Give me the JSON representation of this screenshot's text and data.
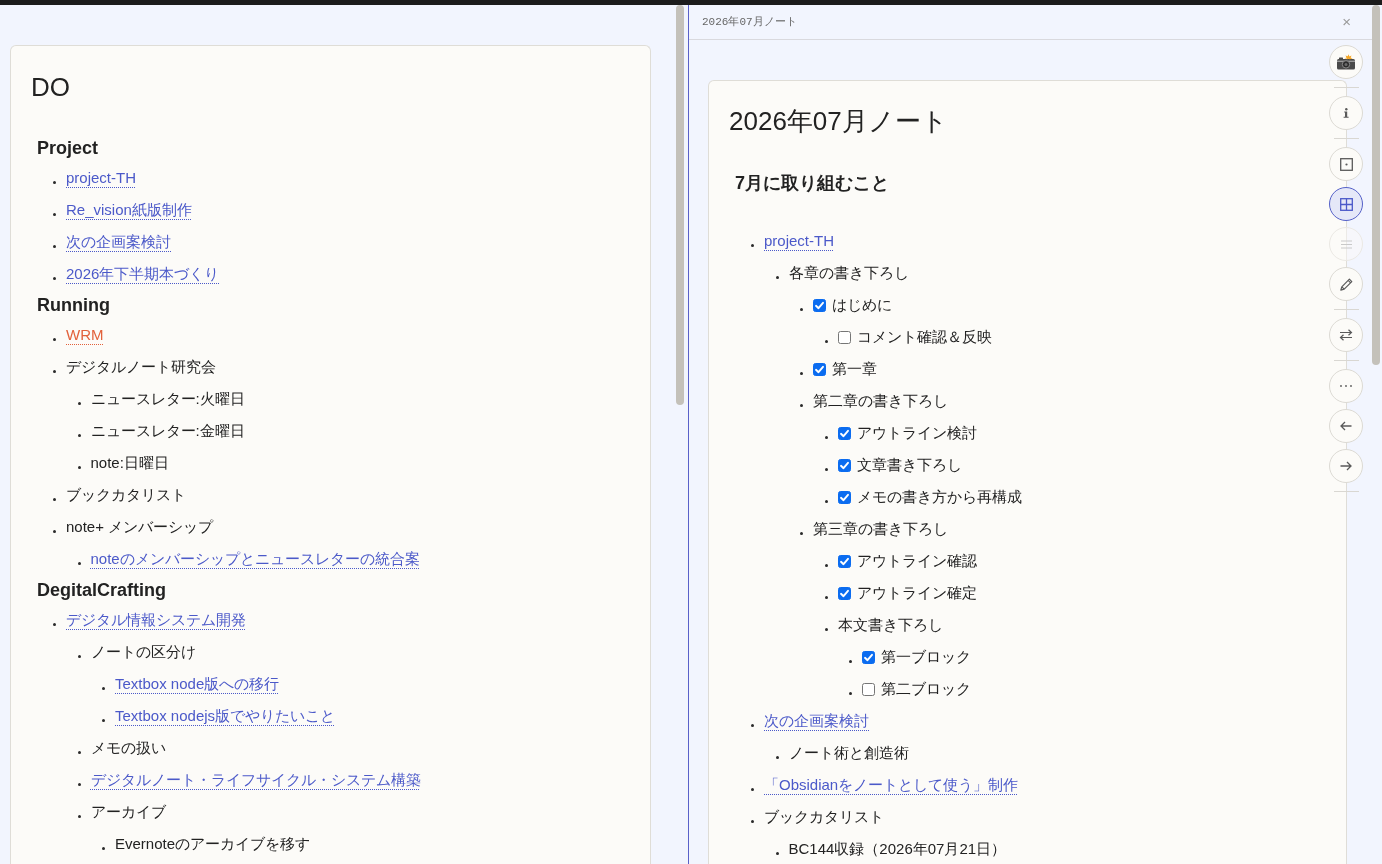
{
  "left_pane": {
    "title": "DO",
    "sections": [
      {
        "heading": "Project",
        "items": [
          {
            "kind": "link",
            "text": "project-TH"
          },
          {
            "kind": "link",
            "text": "Re_vision紙版制作"
          },
          {
            "kind": "link",
            "text": "次の企画案検討"
          },
          {
            "kind": "link",
            "text": "2026年下半期本づくり"
          }
        ]
      },
      {
        "heading": "Running",
        "items": [
          {
            "kind": "missing_link",
            "text": "WRM"
          },
          {
            "kind": "text",
            "text": "デジタルノート研究会",
            "children": [
              {
                "kind": "text",
                "text": "ニュースレター:火曜日"
              },
              {
                "kind": "text",
                "text": "ニュースレター:金曜日"
              },
              {
                "kind": "text",
                "text": "note:日曜日"
              }
            ]
          },
          {
            "kind": "text",
            "text": "ブックカタリスト"
          },
          {
            "kind": "text",
            "text": "note+ メンバーシップ",
            "children": [
              {
                "kind": "link",
                "text": "noteのメンバーシップとニュースレターの統合案"
              }
            ]
          }
        ]
      },
      {
        "heading": "DegitalCrafting",
        "items": [
          {
            "kind": "link",
            "text": "デジタル情報システム開発",
            "children": [
              {
                "kind": "text",
                "text": "ノートの区分け",
                "children": [
                  {
                    "kind": "link",
                    "text": "Textbox node版への移行"
                  },
                  {
                    "kind": "link",
                    "text": "Textbox nodejs版でやりたいこと"
                  }
                ]
              },
              {
                "kind": "text",
                "text": "メモの扱い"
              },
              {
                "kind": "link",
                "text": "デジタルノート・ライフサイクル・システム構築"
              },
              {
                "kind": "text",
                "text": "アーカイブ",
                "children": [
                  {
                    "kind": "text",
                    "text": "Evernoteのアーカイブを移す"
                  }
                ]
              }
            ]
          }
        ]
      }
    ]
  },
  "right_pane": {
    "tab_title": "2026年07月ノート",
    "close_label": "×",
    "title": "2026年07月ノート",
    "heading": "7月に取り組むこと",
    "items": [
      {
        "kind": "link",
        "text": "project-TH",
        "children": [
          {
            "kind": "text",
            "text": "各章の書き下ろし",
            "children": [
              {
                "kind": "task",
                "text": "はじめに",
                "checked": true,
                "children": [
                  {
                    "kind": "task",
                    "text": "コメント確認＆反映",
                    "checked": false
                  }
                ]
              },
              {
                "kind": "task",
                "text": "第一章",
                "checked": true
              },
              {
                "kind": "text",
                "text": "第二章の書き下ろし",
                "children": [
                  {
                    "kind": "task",
                    "text": "アウトライン検討",
                    "checked": true
                  },
                  {
                    "kind": "task",
                    "text": "文章書き下ろし",
                    "checked": true
                  },
                  {
                    "kind": "task",
                    "text": "メモの書き方から再構成",
                    "checked": true
                  }
                ]
              },
              {
                "kind": "text",
                "text": "第三章の書き下ろし",
                "children": [
                  {
                    "kind": "task",
                    "text": "アウトライン確認",
                    "checked": true
                  },
                  {
                    "kind": "task",
                    "text": "アウトライン確定",
                    "checked": true
                  },
                  {
                    "kind": "text",
                    "text": "本文書き下ろし",
                    "children": [
                      {
                        "kind": "task",
                        "text": "第一ブロック",
                        "checked": true
                      },
                      {
                        "kind": "task",
                        "text": "第二ブロック",
                        "checked": false
                      }
                    ]
                  }
                ]
              }
            ]
          }
        ]
      },
      {
        "kind": "link",
        "text": "次の企画案検討",
        "children": [
          {
            "kind": "text",
            "text": "ノート術と創造術"
          }
        ]
      },
      {
        "kind": "link",
        "text": "「Obsidianをノートとして使う」制作"
      },
      {
        "kind": "text",
        "text": "ブックカタリスト",
        "children": [
          {
            "kind": "text",
            "text": "BC144収録（2026年07月21日）"
          }
        ]
      }
    ],
    "toolbar": [
      {
        "buttons": [
          {
            "kind": "camera",
            "selected": false,
            "disabled": false
          }
        ]
      },
      {
        "buttons": [
          {
            "kind": "info",
            "selected": false,
            "disabled": false
          }
        ]
      },
      {
        "buttons": [
          {
            "kind": "frame",
            "selected": false,
            "disabled": false
          },
          {
            "kind": "grid",
            "selected": true,
            "disabled": false
          },
          {
            "kind": "lines",
            "selected": false,
            "disabled": true
          },
          {
            "kind": "pencil",
            "selected": false,
            "disabled": false
          }
        ]
      },
      {
        "buttons": [
          {
            "kind": "swap",
            "selected": false,
            "disabled": false
          }
        ]
      },
      {
        "buttons": [
          {
            "kind": "more",
            "selected": false,
            "disabled": false
          },
          {
            "kind": "back",
            "selected": false,
            "disabled": false
          },
          {
            "kind": "forward",
            "selected": false,
            "disabled": false
          }
        ]
      }
    ]
  }
}
